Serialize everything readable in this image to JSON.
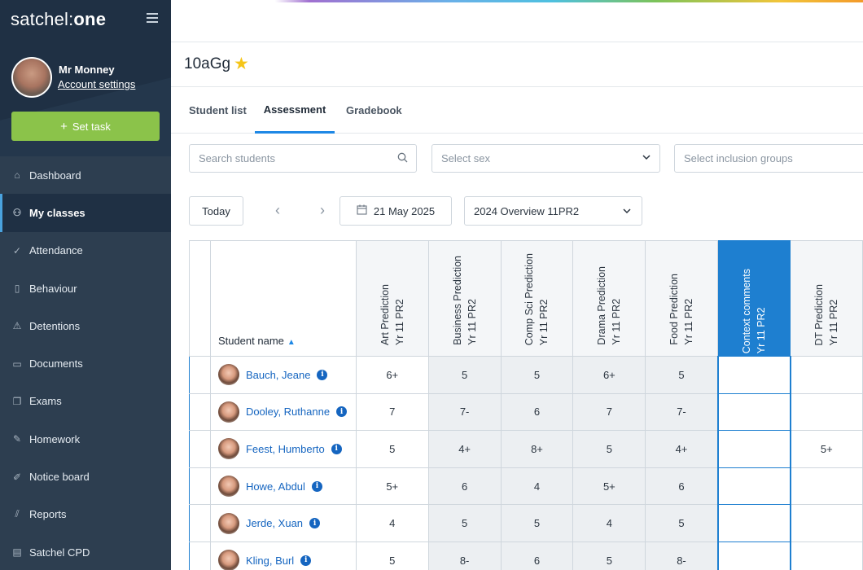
{
  "app": {
    "logo_text": "satchel",
    "logo_bold": "one",
    "logo_sep": ":"
  },
  "user": {
    "name": "Mr Monney",
    "account_link": "Account settings"
  },
  "set_task": {
    "label": "Set task",
    "plus": "+"
  },
  "nav": [
    {
      "label": "Dashboard",
      "icon": "home-icon",
      "glyph": "⌂",
      "active": false
    },
    {
      "label": "My classes",
      "icon": "people-icon",
      "glyph": "⚇",
      "active": true
    },
    {
      "label": "Attendance",
      "icon": "check-icon",
      "glyph": "✓",
      "active": false
    },
    {
      "label": "Behaviour",
      "icon": "clipboard-icon",
      "glyph": "▯",
      "active": false
    },
    {
      "label": "Detentions",
      "icon": "warning-icon",
      "glyph": "⚠",
      "active": false
    },
    {
      "label": "Documents",
      "icon": "document-icon",
      "glyph": "▭",
      "active": false
    },
    {
      "label": "Exams",
      "icon": "copy-icon",
      "glyph": "❐",
      "active": false
    },
    {
      "label": "Homework",
      "icon": "edit-icon",
      "glyph": "✎",
      "active": false
    },
    {
      "label": "Notice board",
      "icon": "pin-icon",
      "glyph": "✐",
      "active": false
    },
    {
      "label": "Reports",
      "icon": "chart-icon",
      "glyph": "⫽",
      "active": false
    },
    {
      "label": "Satchel CPD",
      "icon": "book-icon",
      "glyph": "▤",
      "active": false
    }
  ],
  "page": {
    "class_title": "10aGg"
  },
  "tabs": [
    {
      "label": "Student list",
      "active": false
    },
    {
      "label": "Assessment",
      "active": true
    },
    {
      "label": "Gradebook",
      "active": false
    }
  ],
  "filters": {
    "search_placeholder": "Search students",
    "sex_placeholder": "Select sex",
    "inclusion_placeholder": "Select inclusion groups"
  },
  "date_nav": {
    "today_label": "Today",
    "date": "21 May 2025",
    "overview": "2024 Overview 11PR2"
  },
  "table": {
    "name_header": "Student name",
    "columns": [
      {
        "line1": "Art Prediction",
        "line2": "Yr 11 PR2",
        "highlight": false
      },
      {
        "line1": "Business Prediction",
        "line2": "Yr 11 PR2",
        "highlight": false
      },
      {
        "line1": "Comp Sci Prediction",
        "line2": "Yr 11 PR2",
        "highlight": false
      },
      {
        "line1": "Drama Prediction",
        "line2": "Yr 11 PR2",
        "highlight": false
      },
      {
        "line1": "Food Prediction",
        "line2": "Yr 11 PR2",
        "highlight": false
      },
      {
        "line1": "Context comments",
        "line2": "Yr 11 PR2",
        "highlight": true
      },
      {
        "line1": "DT Prediction",
        "line2": "Yr 11 PR2",
        "highlight": false
      }
    ],
    "rows": [
      {
        "name": "Bauch, Jeane",
        "values": [
          "6+",
          "5",
          "5",
          "6+",
          "5",
          "",
          ""
        ]
      },
      {
        "name": "Dooley, Ruthanne",
        "values": [
          "7",
          "7-",
          "6",
          "7",
          "7-",
          "",
          ""
        ]
      },
      {
        "name": "Feest, Humberto",
        "values": [
          "5",
          "4+",
          "8+",
          "5",
          "4+",
          "",
          "5+"
        ]
      },
      {
        "name": "Howe, Abdul",
        "values": [
          "5+",
          "6",
          "4",
          "5+",
          "6",
          "",
          ""
        ]
      },
      {
        "name": "Jerde, Xuan",
        "values": [
          "4",
          "5",
          "5",
          "4",
          "5",
          "",
          ""
        ]
      },
      {
        "name": "Kling, Burl",
        "values": [
          "5",
          "8-",
          "6",
          "5",
          "8-",
          "",
          ""
        ]
      }
    ]
  }
}
